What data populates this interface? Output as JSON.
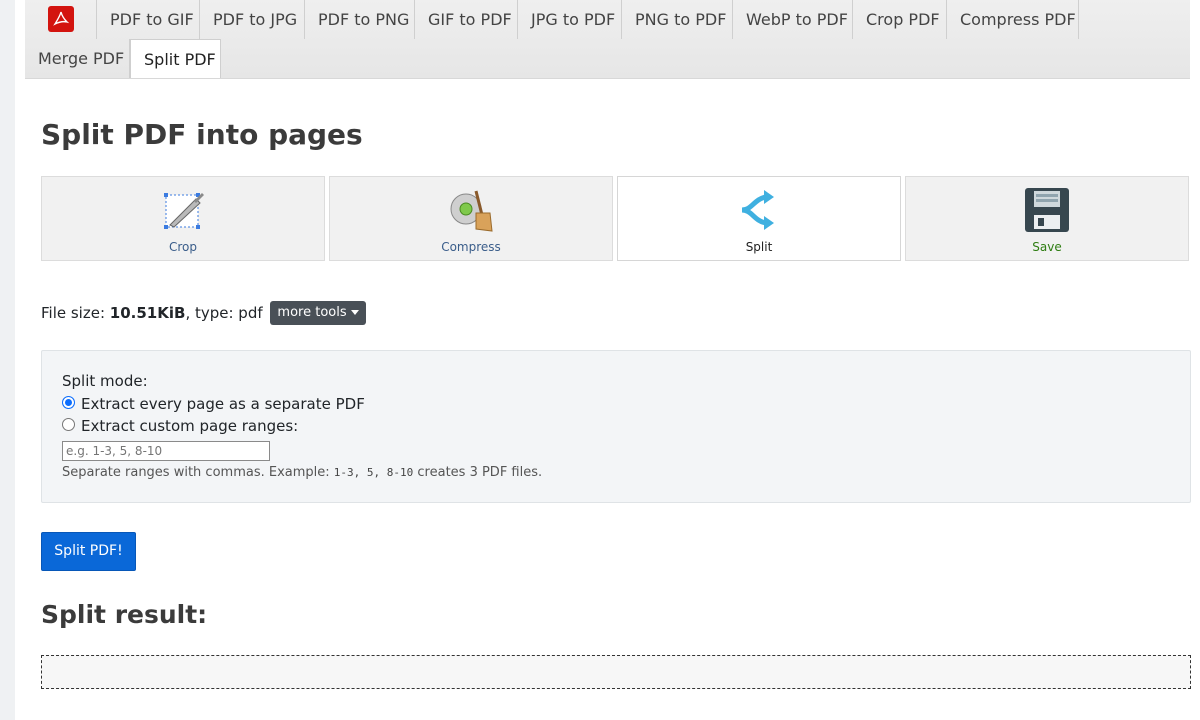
{
  "nav": {
    "items": [
      {
        "label": "PDF to GIF"
      },
      {
        "label": "PDF to JPG"
      },
      {
        "label": "PDF to PNG"
      },
      {
        "label": "GIF to PDF"
      },
      {
        "label": "JPG to PDF"
      },
      {
        "label": "PNG to PDF"
      },
      {
        "label": "WebP to PDF"
      },
      {
        "label": "Crop PDF"
      },
      {
        "label": "Compress PDF"
      },
      {
        "label": "Merge PDF"
      },
      {
        "label": "Split PDF",
        "active": true
      }
    ]
  },
  "page_title": "Split PDF into pages",
  "tools": [
    {
      "label": "Crop",
      "icon": "crop-icon"
    },
    {
      "label": "Compress",
      "icon": "compress-icon"
    },
    {
      "label": "Split",
      "icon": "split-icon",
      "active": true
    },
    {
      "label": "Save",
      "icon": "save-icon"
    }
  ],
  "file_info": {
    "size_label": "File size: ",
    "size_value": "10.51KiB",
    "type_label": ", type: pdf",
    "more_tools_label": "more tools"
  },
  "split_options": {
    "mode_label": "Split mode:",
    "option_every_page": "Extract every page as a separate PDF",
    "option_custom": "Extract custom page ranges:",
    "selected": "every_page",
    "range_placeholder": "e.g. 1-3, 5, 8-10",
    "help_prefix": "Separate ranges with commas. Example: ",
    "help_example": "1-3, 5, 8-10",
    "help_suffix": " creates 3 PDF files."
  },
  "split_button_label": "Split PDF!",
  "result_heading": "Split result:",
  "colors": {
    "accent": "#0a68d8",
    "logo_red": "#d3140f",
    "save_green": "#2e7d12"
  }
}
